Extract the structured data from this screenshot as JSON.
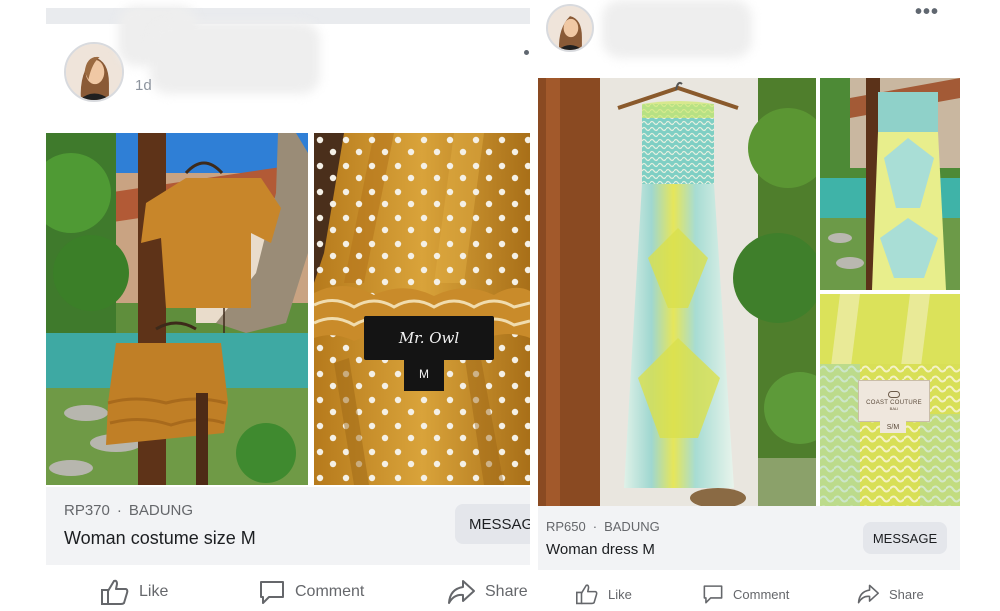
{
  "posts": [
    {
      "time": "1d",
      "listing": {
        "price": "RP370",
        "location": "BADUNG",
        "title": "Woman costume size M",
        "message_label": "MESSAGE"
      },
      "photos": [
        {
          "label_brand": "",
          "label_size": ""
        },
        {
          "label_brand": "Mr. Owl",
          "label_size": "M"
        }
      ],
      "actions": {
        "like": "Like",
        "comment": "Comment",
        "share": "Share"
      }
    },
    {
      "listing": {
        "price": "RP650",
        "location": "BADUNG",
        "title": "Woman dress M",
        "message_label": "MESSAGE"
      },
      "photos": [
        {
          "label_brand": "COAST COUTURE",
          "label_sub": "BALI",
          "label_size": "S/M"
        }
      ],
      "actions": {
        "like": "Like",
        "comment": "Comment",
        "share": "Share"
      }
    }
  ],
  "icons": {
    "like": "thumbs-up-icon",
    "comment": "speech-bubble-icon",
    "share": "share-arrow-icon",
    "more": "more-options-icon"
  },
  "colors": {
    "panel": "#f2f3f5",
    "button": "#e4e6eb",
    "secondary_text": "#65676b",
    "mustard": "#d39c2f"
  }
}
